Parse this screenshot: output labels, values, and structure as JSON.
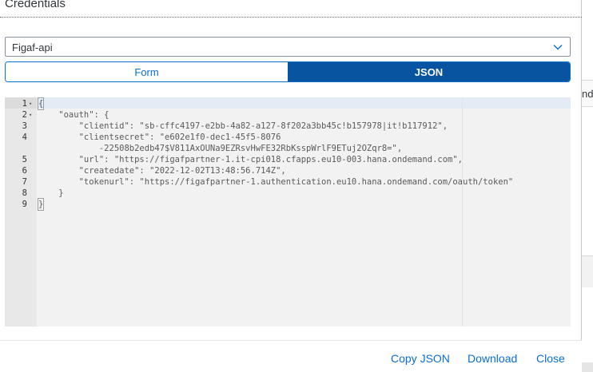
{
  "dialog": {
    "title": "Credentials"
  },
  "background": {
    "tab_fragment": "nd"
  },
  "select": {
    "value": "Figaf-api",
    "icon": "chevron-down-icon"
  },
  "view_toggle": {
    "form_label": "Form",
    "json_label": "JSON",
    "selected": "JSON"
  },
  "editor": {
    "lines": [
      {
        "num": "1",
        "fold": "▾",
        "text": "{"
      },
      {
        "num": "2",
        "fold": "▾",
        "text": "    \"oauth\": {"
      },
      {
        "num": "3",
        "fold": "",
        "text": "        \"clientid\": \"sb-cffc4197-e2bb-4a82-a127-8f202a3bb45c!b157978|it!b117912\","
      },
      {
        "num": "4",
        "fold": "",
        "text": "        \"clientsecret\": \"e602e1f0-dec1-45f5-8076\n            -22508b2edb47$V811AxOUNa9EZRsvHwFE32RbKsspWrlF9ETuj2OZqr8=\","
      },
      {
        "num": "5",
        "fold": "",
        "text": "        \"url\": \"https://figafpartner-1.it-cpi018.cfapps.eu10-003.hana.ondemand.com\","
      },
      {
        "num": "6",
        "fold": "",
        "text": "        \"createdate\": \"2022-12-02T13:48:56.714Z\","
      },
      {
        "num": "7",
        "fold": "",
        "text": "        \"tokenurl\": \"https://figafpartner-1.authentication.eu10.hana.ondemand.com/oauth/token\""
      },
      {
        "num": "8",
        "fold": "",
        "text": "    }"
      },
      {
        "num": "9",
        "fold": "",
        "text": "}"
      }
    ]
  },
  "footer": {
    "copy_label": "Copy JSON",
    "download_label": "Download",
    "close_label": "Close"
  },
  "colors": {
    "accent": "#0a6ed1",
    "selected_segment": "#0854a0",
    "editor_bg": "#f2f2f2"
  }
}
